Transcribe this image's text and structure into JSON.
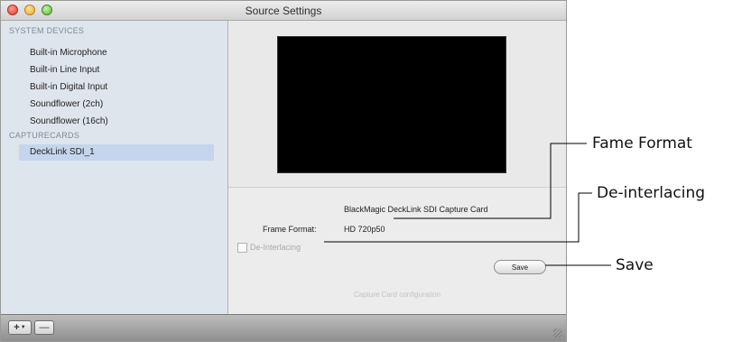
{
  "window": {
    "title": "Source Settings"
  },
  "sidebar": {
    "sections": [
      {
        "title": "SYSTEM DEVICES",
        "items": [
          "Built-in Microphone",
          "Built-in Line Input",
          "Built-in Digital Input",
          "Soundflower (2ch)",
          "Soundflower (16ch)"
        ]
      },
      {
        "title": "CAPTURECARDS",
        "items": [
          "DeckLink SDI_1"
        ]
      }
    ],
    "selected_item": "DeckLink SDI_1"
  },
  "main": {
    "card_name": "BlackMagic DeckLink SDI Capture Card",
    "frame_format_label": "Frame Format:",
    "frame_format_value": "HD 720p50",
    "deinterlacing_label": "De-Interlacing",
    "deinterlacing_checked": false,
    "save_label": "Save",
    "footer_text": "Capture Card configuration"
  },
  "bottom_bar": {
    "add_label": "+",
    "remove_label": "—"
  },
  "callouts": {
    "frame_format": "Fame Format",
    "deinterlacing": "De-interlacing",
    "save": "Save"
  },
  "icons": {
    "close": "close-button",
    "minimize": "minimize-button",
    "zoom": "zoom-button",
    "add_menu_caret": "chevron-down-icon",
    "resize": "resize-grip-icon"
  },
  "colors": {
    "sidebar_background": "#dfe5ec",
    "selection": "#c5d5ee",
    "preview_background": "#000000"
  }
}
